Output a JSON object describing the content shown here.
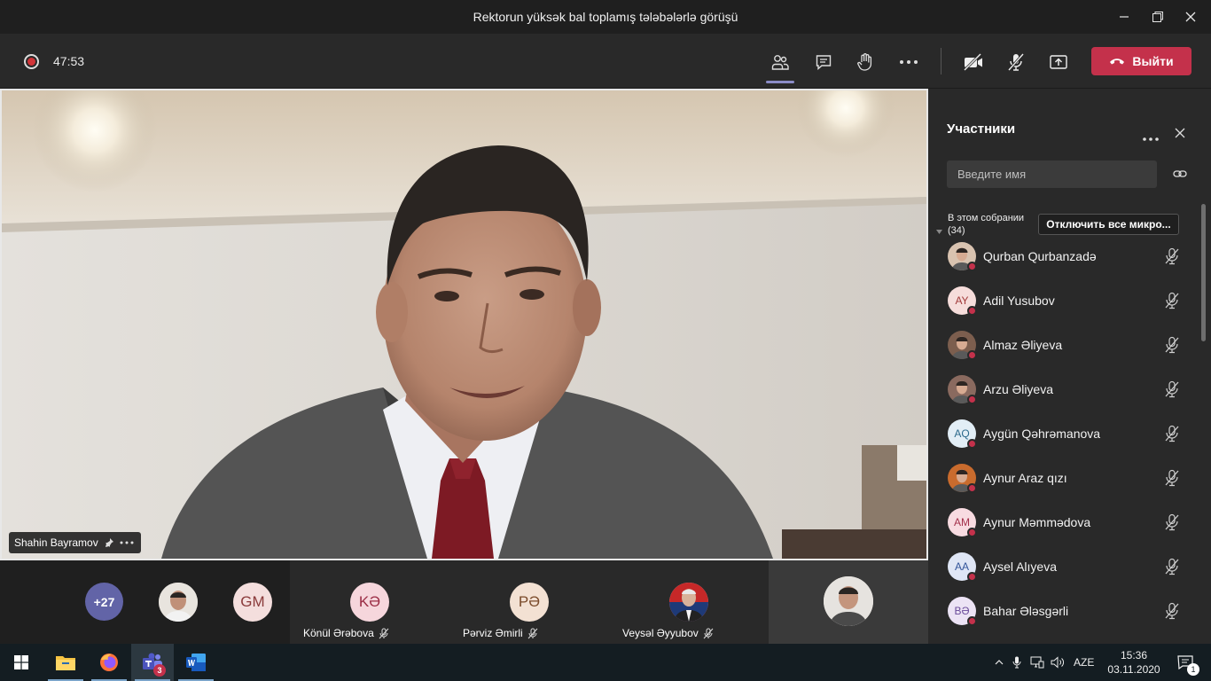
{
  "window": {
    "title": "Rektorun yüksək bal toplamış tələbələrlə görüşü"
  },
  "toolbar": {
    "timer": "47:53",
    "leave_label": "Выйти"
  },
  "main_video": {
    "speaker_name": "Shahin Bayramov"
  },
  "strip": {
    "overflow_count": "+27",
    "avatars": [
      {
        "initials": "GM"
      }
    ],
    "tiles": [
      {
        "initials": "KƏ",
        "name": "Könül Ərəbova"
      },
      {
        "initials": "PƏ",
        "name": "Pərviz Əmirli"
      },
      {
        "initials": "",
        "name": "Veysəl Əyyubov"
      }
    ]
  },
  "panel": {
    "title": "Участники",
    "search_placeholder": "Введите имя",
    "section_label": "В этом собрании",
    "section_count": "(34)",
    "mute_all_label": "Отключить все микро...",
    "participants": [
      {
        "initials": "",
        "name": "Qurban Qurbanzadə"
      },
      {
        "initials": "AY",
        "name": "Adil Yusubov"
      },
      {
        "initials": "",
        "name": "Almaz Əliyeva"
      },
      {
        "initials": "",
        "name": "Arzu Əliyeva"
      },
      {
        "initials": "AQ",
        "name": "Aygün Qəhrəmanova"
      },
      {
        "initials": "",
        "name": "Aynur Araz qızı"
      },
      {
        "initials": "AM",
        "name": "Aynur Məmmədova"
      },
      {
        "initials": "AA",
        "name": "Aysel Alıyeva"
      },
      {
        "initials": "BƏ",
        "name": "Bahar Ələsgərli"
      }
    ]
  },
  "taskbar": {
    "teams_badge": "3",
    "language": "AZE",
    "time": "15:36",
    "date": "03.11.2020",
    "notifications": "1"
  },
  "colors": {
    "accent": "#6264a7",
    "leave": "#c4314b",
    "record": "#d13438"
  }
}
